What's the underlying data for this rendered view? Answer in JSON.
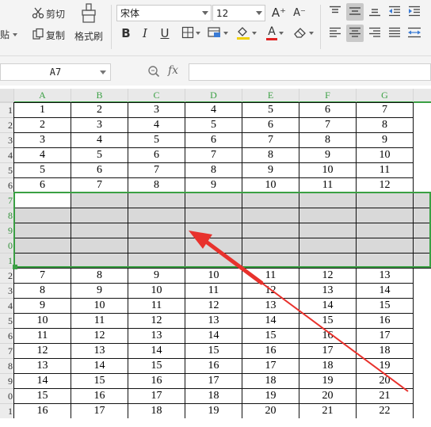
{
  "ribbon": {
    "cut_label": "剪切",
    "paste_label": "粘贴",
    "copy_label": "复制",
    "format_painter_label": "格式刷",
    "font_name": "宋体",
    "font_size": "12",
    "bold_label": "B",
    "italic_label": "I",
    "underline_label": "U",
    "increase_font_label": "A⁺",
    "decrease_font_label": "A⁻",
    "font_color_label": "A",
    "font_color": "#e02020",
    "fill_color": "#f0d000"
  },
  "formula_bar": {
    "name_box": "A7",
    "fx_label": "fx",
    "formula": ""
  },
  "sheet": {
    "columns": [
      "A",
      "B",
      "C",
      "D",
      "E",
      "F",
      "G"
    ],
    "row_numbers": [
      "1",
      "2",
      "3",
      "4",
      "5",
      "6",
      "7",
      "8",
      "9",
      "0",
      "1",
      "2",
      "3",
      "4",
      "5",
      "6",
      "7",
      "8",
      "9",
      "0",
      "1"
    ],
    "rows": [
      [
        "1",
        "2",
        "3",
        "4",
        "5",
        "6",
        "7"
      ],
      [
        "2",
        "3",
        "4",
        "5",
        "6",
        "7",
        "8"
      ],
      [
        "3",
        "4",
        "5",
        "6",
        "7",
        "8",
        "9"
      ],
      [
        "4",
        "5",
        "6",
        "7",
        "8",
        "9",
        "10"
      ],
      [
        "5",
        "6",
        "7",
        "8",
        "9",
        "10",
        "11"
      ],
      [
        "6",
        "7",
        "8",
        "9",
        "10",
        "11",
        "12"
      ],
      [
        "",
        "",
        "",
        "",
        "",
        "",
        ""
      ],
      [
        "",
        "",
        "",
        "",
        "",
        "",
        ""
      ],
      [
        "",
        "",
        "",
        "",
        "",
        "",
        ""
      ],
      [
        "",
        "",
        "",
        "",
        "",
        "",
        ""
      ],
      [
        "",
        "",
        "",
        "",
        "",
        "",
        ""
      ],
      [
        "7",
        "8",
        "9",
        "10",
        "11",
        "12",
        "13"
      ],
      [
        "8",
        "9",
        "10",
        "11",
        "12",
        "13",
        "14"
      ],
      [
        "9",
        "10",
        "11",
        "12",
        "13",
        "14",
        "15"
      ],
      [
        "10",
        "11",
        "12",
        "13",
        "14",
        "15",
        "16"
      ],
      [
        "11",
        "12",
        "13",
        "14",
        "15",
        "16",
        "17"
      ],
      [
        "12",
        "13",
        "14",
        "15",
        "16",
        "17",
        "18"
      ],
      [
        "13",
        "14",
        "15",
        "16",
        "17",
        "18",
        "19"
      ],
      [
        "14",
        "15",
        "16",
        "17",
        "18",
        "19",
        "20"
      ],
      [
        "15",
        "16",
        "17",
        "18",
        "19",
        "20",
        "21"
      ],
      [
        "16",
        "17",
        "18",
        "19",
        "20",
        "21",
        "22"
      ]
    ],
    "selected_rows": [
      6,
      7,
      8,
      9,
      10
    ],
    "selection_color": "#3aa043",
    "annotation_color": "#e8322d"
  }
}
